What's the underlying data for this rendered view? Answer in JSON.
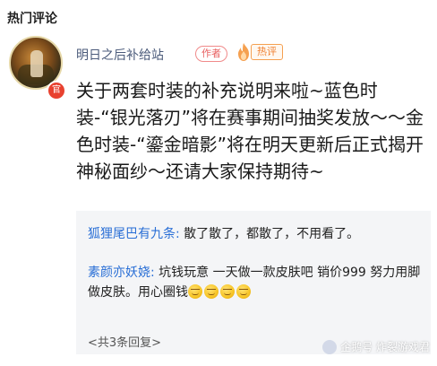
{
  "section": {
    "title": "热门评论"
  },
  "comment": {
    "username": "明日之后补给站",
    "author_tag": "作者",
    "hot_tag": "热评",
    "official_badge": "官",
    "text": "关于两套时装的补充说明来啦~蓝色时装-“银光落刃”将在赛事期间抽奖发放～～金色时装-“鎏金暗影”将在明天更新后正式揭开神秘面纱～还请大家保持期待~"
  },
  "replies": [
    {
      "name": "狐狸尾巴有九条:",
      "text": " 散了散了，都散了，不用看了。"
    },
    {
      "name": "素颜亦妖娆:",
      "text": " 坑钱玩意 一天做一款皮肤吧 销价999 努力用脚做皮肤。用心圈钱",
      "emoji_count": 4,
      "emoji_icon": "smirk-face-icon"
    }
  ],
  "more_replies": "<共3条回复>",
  "watermark": "企鹅号 炸裂游戏君",
  "colors": {
    "reply_name": "#2a6fd6",
    "author_tag": "#e86060",
    "hot_tag": "#f08030",
    "official_badge": "#e8412f",
    "reply_bg": "#f4f5f7"
  }
}
